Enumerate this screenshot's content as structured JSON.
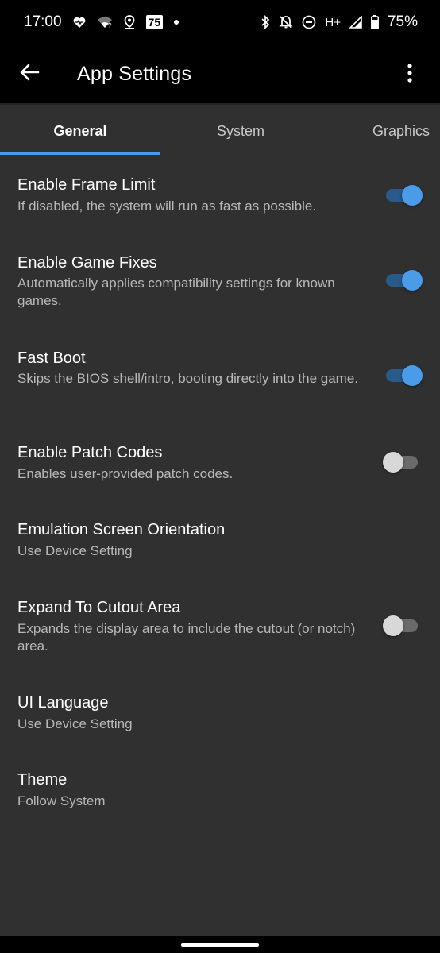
{
  "status_bar": {
    "time": "17:00",
    "badge": "75",
    "network": "H+",
    "battery": "75%"
  },
  "app_bar": {
    "title": "App Settings",
    "back_icon": "arrow-back-icon",
    "overflow_icon": "more-vert-icon"
  },
  "tabs": [
    {
      "label": "General",
      "active": true
    },
    {
      "label": "System",
      "active": false
    },
    {
      "label": "Graphics",
      "active": false
    }
  ],
  "settings": [
    {
      "title": "Enable Frame Limit",
      "summary": "If disabled, the system will run as fast as possible.",
      "switch": "on"
    },
    {
      "title": "Enable Game Fixes",
      "summary": "Automatically applies compatibility settings for known games.",
      "switch": "on"
    },
    {
      "title": "Fast Boot",
      "summary": "Skips the BIOS shell/intro, booting directly into the game.",
      "switch": "on"
    },
    {
      "title": "Enable Patch Codes",
      "summary": "Enables user-provided patch codes.",
      "switch": "off"
    },
    {
      "title": "Emulation Screen Orientation",
      "summary": "Use Device Setting"
    },
    {
      "title": "Expand To Cutout Area",
      "summary": "Expands the display area to include the cutout (or notch) area.",
      "switch": "off"
    },
    {
      "title": "UI Language",
      "summary": "Use Device Setting"
    },
    {
      "title": "Theme",
      "summary": "Follow System"
    }
  ],
  "colors": {
    "accent": "#4a9be8",
    "background": "#303030",
    "bar": "#000000"
  }
}
